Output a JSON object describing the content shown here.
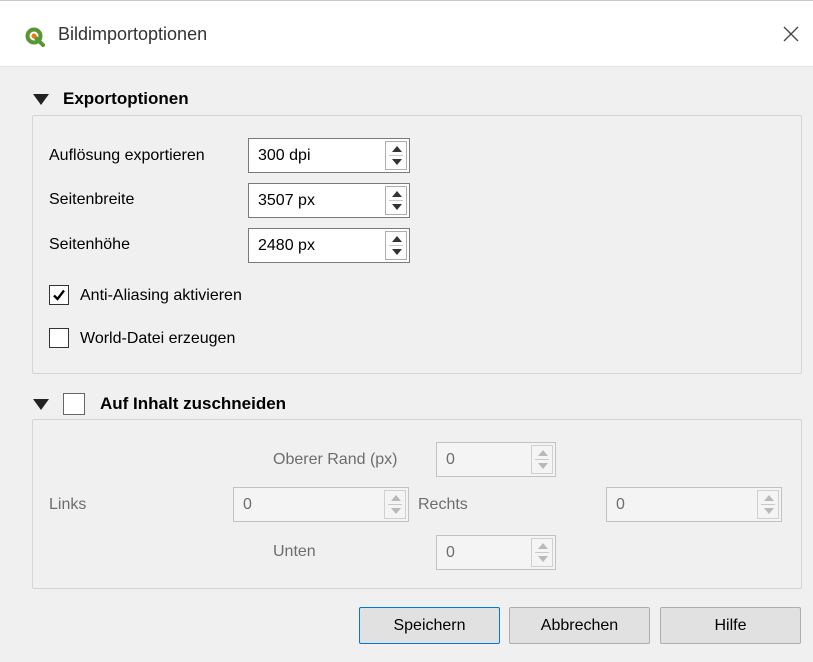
{
  "window": {
    "title": "Bildimportoptionen",
    "icon": "qgis-logo-icon",
    "close_icon": "close-icon"
  },
  "export_options": {
    "header": "Exportoptionen",
    "resolution": {
      "label": "Auflösung exportieren",
      "value": "300 dpi"
    },
    "page_width": {
      "label": "Seitenbreite",
      "value": "3507 px"
    },
    "page_height": {
      "label": "Seitenhöhe",
      "value": "2480 px"
    },
    "anti_aliasing": {
      "label": "Anti-Aliasing aktivieren",
      "checked": true
    },
    "world_file": {
      "label": "World-Datei erzeugen",
      "checked": false
    }
  },
  "crop": {
    "header": "Auf Inhalt zuschneiden",
    "checked": false,
    "top": {
      "label": "Oberer Rand (px)",
      "value": "0"
    },
    "left": {
      "label": "Links",
      "value": "0"
    },
    "right": {
      "label": "Rechts",
      "value": "0"
    },
    "bottom": {
      "label": "Unten",
      "value": "0"
    }
  },
  "buttons": {
    "save": "Speichern",
    "cancel": "Abbrechen",
    "help": "Hilfe"
  }
}
